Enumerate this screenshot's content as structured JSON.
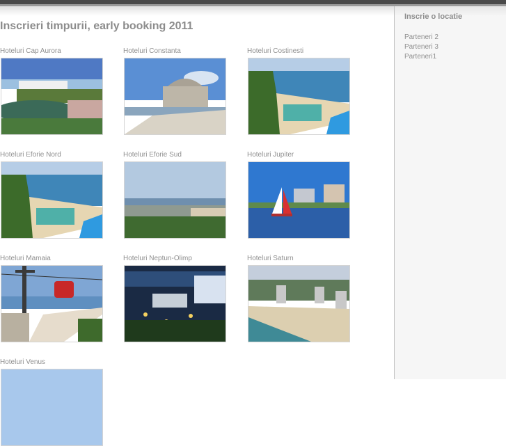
{
  "page": {
    "title": "Inscrieri timpurii, early booking 2011"
  },
  "gallery": [
    {
      "label": "Hoteluri Cap Aurora",
      "image_icon": "beach-photo"
    },
    {
      "label": "Hoteluri Constanta",
      "image_icon": "casino-building-photo"
    },
    {
      "label": "Hoteluri Costinesti",
      "image_icon": "beach-pool-photo"
    },
    {
      "label": "Hoteluri Eforie Nord",
      "image_icon": "beach-pool-photo"
    },
    {
      "label": "Hoteluri Eforie Sud",
      "image_icon": "coast-photo"
    },
    {
      "label": "Hoteluri Jupiter",
      "image_icon": "sailboat-photo"
    },
    {
      "label": "Hoteluri Mamaia",
      "image_icon": "cable-car-photo"
    },
    {
      "label": "Hoteluri Neptun-Olimp",
      "image_icon": "night-resort-photo"
    },
    {
      "label": "Hoteluri Saturn",
      "image_icon": "aerial-beach-photo"
    },
    {
      "label": "Hoteluri Venus",
      "image_icon": "sky-photo"
    }
  ],
  "sidebar": {
    "heading": "Inscrie o locatie",
    "partners": [
      "Parteneri 2",
      "Parteneri 3",
      "Parteneri1"
    ]
  },
  "colors": {
    "text_gray": "#8c8c8c",
    "sidebar_bg": "#f6f6f6",
    "top_bar": "#4a4a4a"
  }
}
